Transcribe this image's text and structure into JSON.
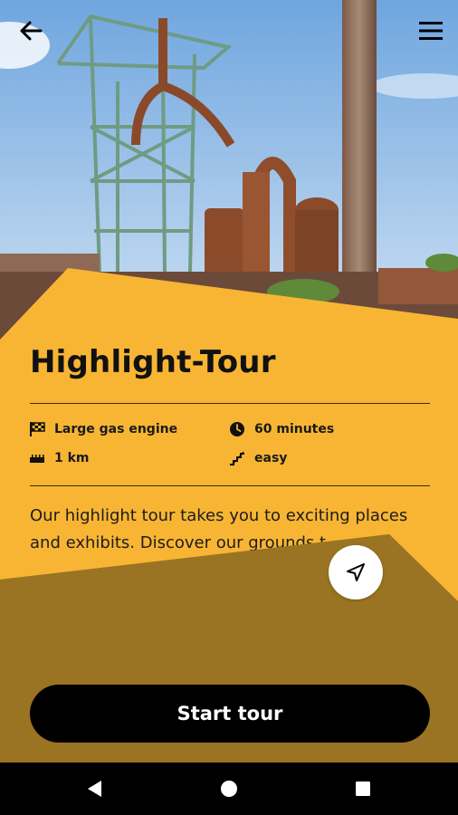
{
  "tour": {
    "title": "Highlight-Tour",
    "stats": {
      "start": "Large gas engine",
      "duration": "60 minutes",
      "distance": "1 km",
      "difficulty": "easy"
    },
    "description": "Our highlight tour takes you to exciting places and exhibits. Discover our grounds t..."
  },
  "actions": {
    "start_label": "Start tour"
  },
  "icons": {
    "back": "arrow-left-icon",
    "menu": "hamburger-menu-icon",
    "start": "checkered-flag-icon",
    "duration": "clock-icon",
    "distance": "ruler-icon",
    "difficulty": "stairs-icon",
    "locate": "navigation-arrow-icon",
    "nav_back": "triangle-back-icon",
    "nav_home": "circle-home-icon",
    "nav_recents": "square-recents-icon"
  },
  "colors": {
    "accent_yellow": "#F8B533",
    "accent_brown": "#9A7423",
    "button_black": "#000000",
    "text_dark": "#111111"
  }
}
